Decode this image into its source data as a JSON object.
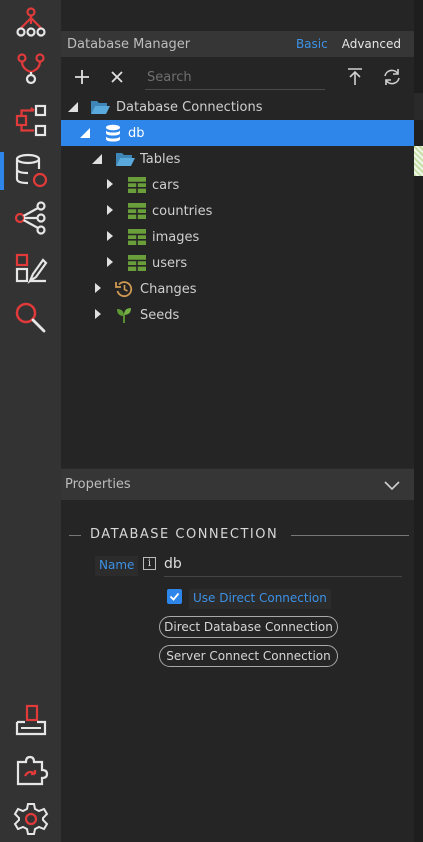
{
  "rail": {
    "items": [
      {
        "icon": "hierarchy-icon"
      },
      {
        "icon": "merge-icon"
      },
      {
        "icon": "workflow-icon"
      },
      {
        "icon": "database-icon",
        "active": true
      },
      {
        "icon": "share-icon"
      },
      {
        "icon": "design-edit-icon"
      },
      {
        "icon": "search-icon"
      }
    ],
    "bottom_items": [
      {
        "icon": "export-icon"
      },
      {
        "icon": "plugin-icon"
      },
      {
        "icon": "settings-icon"
      }
    ]
  },
  "header": {
    "title": "Database Manager",
    "mode_basic": "Basic",
    "mode_advanced": "Advanced"
  },
  "toolbar": {
    "search_placeholder": "Search"
  },
  "tree": {
    "root": "Database Connections",
    "db": "db",
    "tables_folder": "Tables",
    "tables": [
      "cars",
      "countries",
      "images",
      "users"
    ],
    "changes": "Changes",
    "seeds": "Seeds"
  },
  "properties": {
    "title": "Properties",
    "section_title": "DATABASE CONNECTION",
    "name_label": "Name",
    "name_value": "db",
    "use_direct_label": "Use Direct Connection",
    "use_direct_checked": true,
    "direct_button": "Direct Database Connection",
    "server_button": "Server Connect Connection"
  },
  "colors": {
    "accent": "#2f86ea",
    "red": "#e03a3a",
    "table_green": "#6a9e3a",
    "folder_blue": "#4f9fd6"
  }
}
